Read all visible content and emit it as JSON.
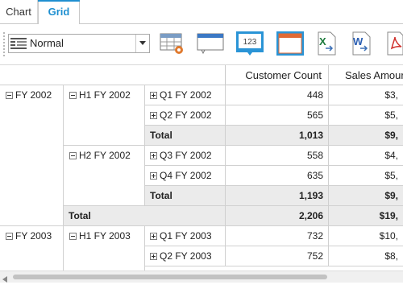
{
  "tabs": [
    {
      "label": "Chart"
    },
    {
      "label": "Grid"
    }
  ],
  "toolbar": {
    "layout_select_value": "Normal",
    "icons": [
      "layout-lines-icon",
      "field-list-icon",
      "tooltip-icon",
      "value-display-icon",
      "window-icon",
      "excel-export-icon",
      "word-export-icon",
      "pdf-export-icon"
    ]
  },
  "grid": {
    "headers": [
      "Customer Count",
      "Sales Amour"
    ],
    "years": [
      {
        "label": "FY 2002"
      },
      {
        "label": "FY 2003"
      }
    ],
    "halves": [
      {
        "label": "H1 FY 2002"
      },
      {
        "label": "H2 FY 2002"
      },
      {
        "label": "H1 FY 2003"
      }
    ],
    "rows": [
      {
        "quarter": "Q1 FY 2002",
        "customers": "448",
        "sales": "$3,"
      },
      {
        "quarter": "Q2 FY 2002",
        "customers": "565",
        "sales": "$5,"
      },
      {
        "quarter": "Total",
        "customers": "1,013",
        "sales": "$9,"
      },
      {
        "quarter": "Q3 FY 2002",
        "customers": "558",
        "sales": "$4,"
      },
      {
        "quarter": "Q4 FY 2002",
        "customers": "635",
        "sales": "$5,"
      },
      {
        "quarter": "Total",
        "customers": "1,193",
        "sales": "$9,"
      },
      {
        "quarter": "Total",
        "customers": "2,206",
        "sales": "$19,"
      },
      {
        "quarter": "Q1 FY 2003",
        "customers": "732",
        "sales": "$10,"
      },
      {
        "quarter": "Q2 FY 2003",
        "customers": "752",
        "sales": "$8,"
      }
    ]
  },
  "colors": {
    "accent": "#1e8fd0",
    "total_row_bg": "#ebebeb",
    "grid_line": "#d0d0d0"
  }
}
